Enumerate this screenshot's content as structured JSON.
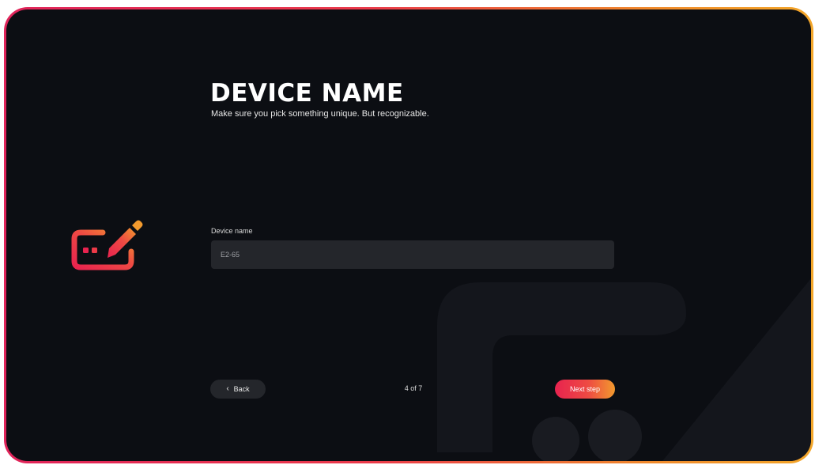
{
  "header": {
    "title": "DEVICE NAME",
    "subtitle": "Make sure you pick something unique. But recognizable."
  },
  "form": {
    "label": "Device name",
    "value": "E2-65"
  },
  "footer": {
    "back_label": "Back",
    "step": "4 of 7",
    "next_label": "Next step"
  },
  "icons": {
    "hero": "edit-device-icon",
    "back": "chevron-left-icon"
  },
  "colors": {
    "accent_start": "#e8234f",
    "accent_end": "#f29a2e",
    "background": "#0c0e13",
    "field": "#24262b"
  }
}
